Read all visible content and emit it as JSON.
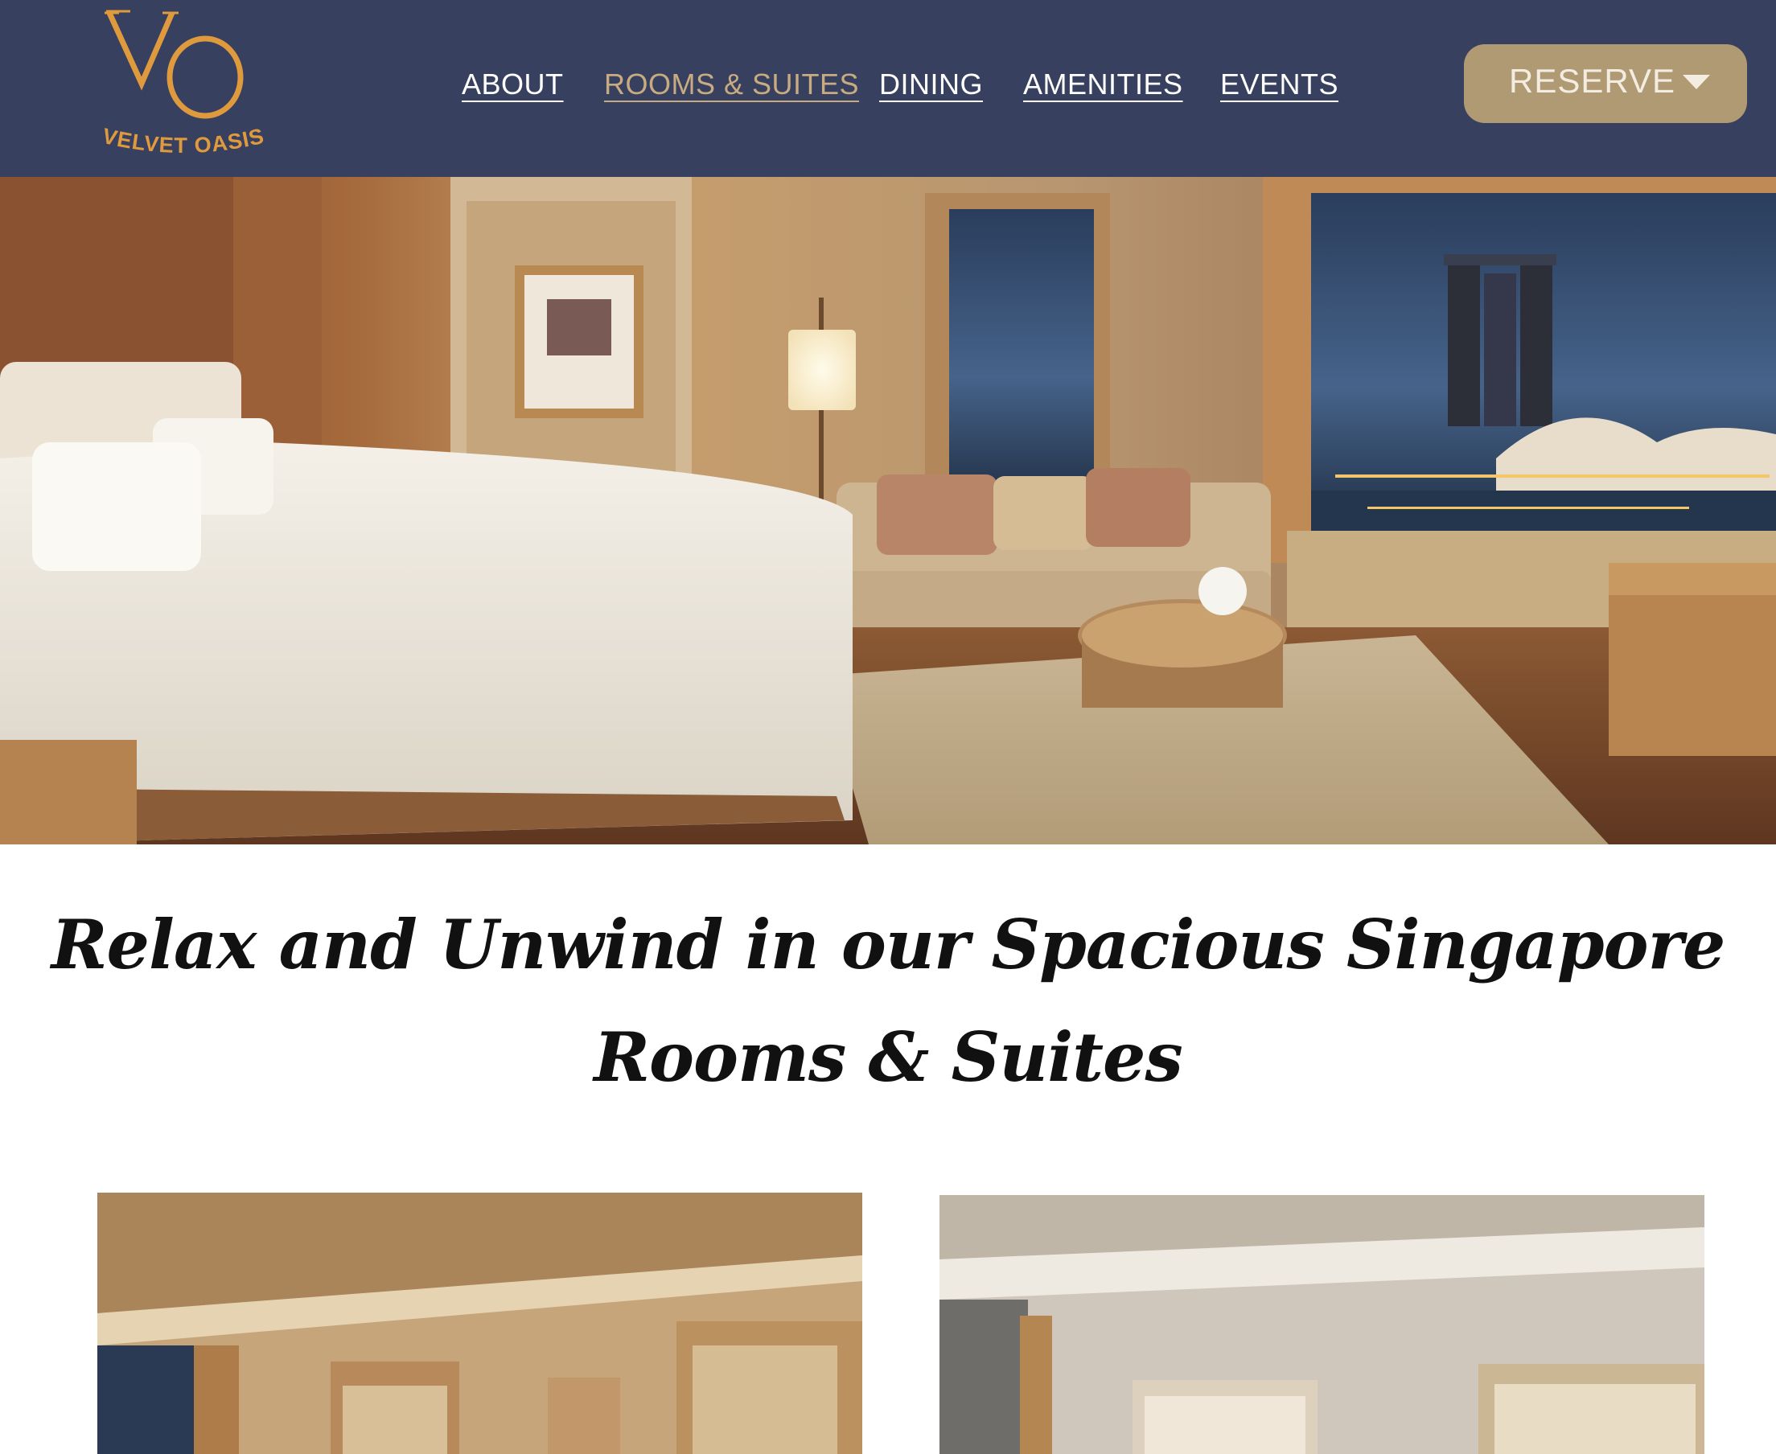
{
  "brand": {
    "monogram": "VO",
    "name": "VELVET OASIS",
    "color": "#e09a3e"
  },
  "nav": {
    "items": [
      {
        "label": "ABOUT",
        "active": false
      },
      {
        "label": "ROOMS & SUITES",
        "active": true
      },
      {
        "label": "DINING",
        "active": false
      },
      {
        "label": "AMENITIES",
        "active": false
      },
      {
        "label": "EVENTS",
        "active": false
      }
    ]
  },
  "reserve": {
    "label": "RESERVE",
    "icon": "caret-down-icon"
  },
  "hero": {
    "image": "hotel-room-photo"
  },
  "headline": {
    "line1": "Relax and Unwind in our Spacious Singapore",
    "line2": "Rooms & Suites"
  },
  "cards": [
    {
      "image": "room-photo"
    },
    {
      "image": "room-photo"
    }
  ],
  "colors": {
    "header_bg": "#37405e",
    "accent_gold": "#c8ab80",
    "button_bg": "#b09a74",
    "logo_orange": "#e09a3e"
  }
}
